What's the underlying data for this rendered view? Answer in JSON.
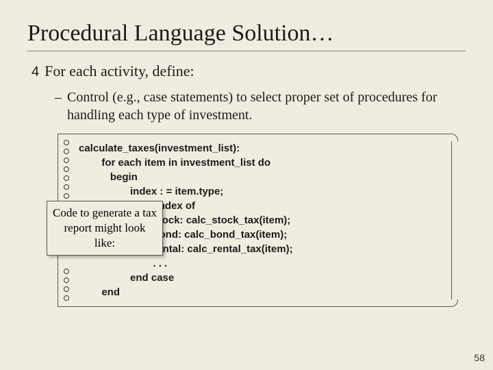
{
  "title": "Procedural Language Solution…",
  "bullet1": {
    "mark": "4",
    "text": "For each activity, define:"
  },
  "bullet2": {
    "mark": "–",
    "text": "Control (e.g., case statements) to select proper set of procedures for handling each type of investment."
  },
  "callout": "Code to generate a tax report might look like:",
  "code": {
    "l1": "calculate_taxes(investment_list):",
    "l2": "        for each item in investment_list do",
    "l3": "           begin",
    "l4": "                  index : = item.type;",
    "l5": "                  case index of",
    "l6": "                          stock: calc_stock_tax(item);",
    "l7": "                          bond: calc_bond_tax(item);",
    "l8": "                          rental: calc_rental_tax(item);",
    "l9": "                          . . .",
    "l10": "                  end case",
    "l11": "        end"
  },
  "page_number": "58"
}
